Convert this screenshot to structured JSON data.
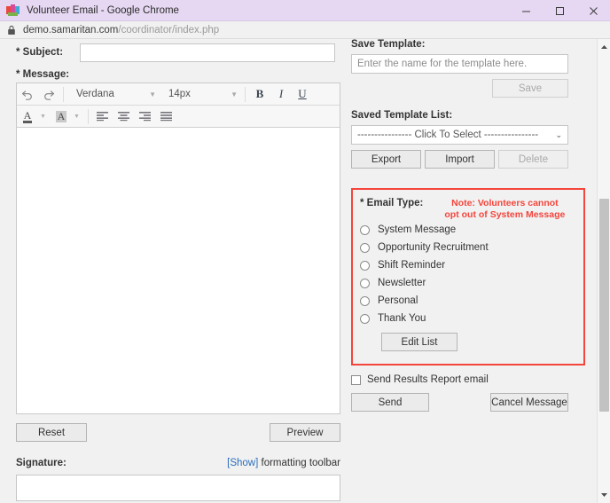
{
  "window": {
    "title": "Volunteer Email - Google Chrome",
    "favicon": "chrome-app-icon",
    "minimize": "minimize-icon",
    "maximize": "maximize-icon",
    "close": "close-icon"
  },
  "urlbar": {
    "lock_icon": "lock-icon",
    "host": "demo.samaritan.com",
    "path": "/coordinator/index.php"
  },
  "form": {
    "subject_label": "* Subject:",
    "subject_value": "",
    "message_label": "* Message:",
    "message_value": ""
  },
  "editor_toolbar": {
    "undo": "undo-icon",
    "redo": "redo-icon",
    "font_family": "Verdana",
    "font_size": "14px",
    "bold": "B",
    "italic": "I",
    "underline": "U",
    "text_color": "A",
    "highlight_color": "A",
    "align_left": "align-left-icon",
    "align_center": "align-center-icon",
    "align_right": "align-right-icon",
    "align_justify": "align-justify-icon"
  },
  "left_buttons": {
    "reset": "Reset",
    "preview": "Preview"
  },
  "signature": {
    "label": "Signature:",
    "show_link": "[Show]",
    "show_suffix": " formatting toolbar",
    "value": ""
  },
  "template": {
    "save_label": "Save Template:",
    "name_placeholder": "Enter the name for the template here.",
    "name_value": "",
    "save_button": "Save",
    "list_label": "Saved Template List:",
    "selected_option": "---------------- Click To Select ----------------",
    "export_button": "Export",
    "import_button": "Import",
    "delete_button": "Delete"
  },
  "email_type": {
    "title": "* Email Type:",
    "note_line1": "Note: Volunteers cannot",
    "note_line2": "opt out of System Message",
    "note_color": "#f4453c",
    "border_color": "#f4453c",
    "options": [
      {
        "label": "System Message",
        "selected": false
      },
      {
        "label": "Opportunity Recruitment",
        "selected": false
      },
      {
        "label": "Shift Reminder",
        "selected": false
      },
      {
        "label": "Newsletter",
        "selected": false
      },
      {
        "label": "Personal",
        "selected": false
      },
      {
        "label": "Thank You",
        "selected": false
      }
    ],
    "edit_list_button": "Edit List"
  },
  "actions": {
    "report_checkbox_label": "Send Results Report email",
    "report_checked": false,
    "send_button": "Send",
    "cancel_button": "Cancel Message"
  },
  "scrollbar": {
    "up_arrow": "scroll-up-icon",
    "down_arrow": "scroll-down-icon"
  }
}
